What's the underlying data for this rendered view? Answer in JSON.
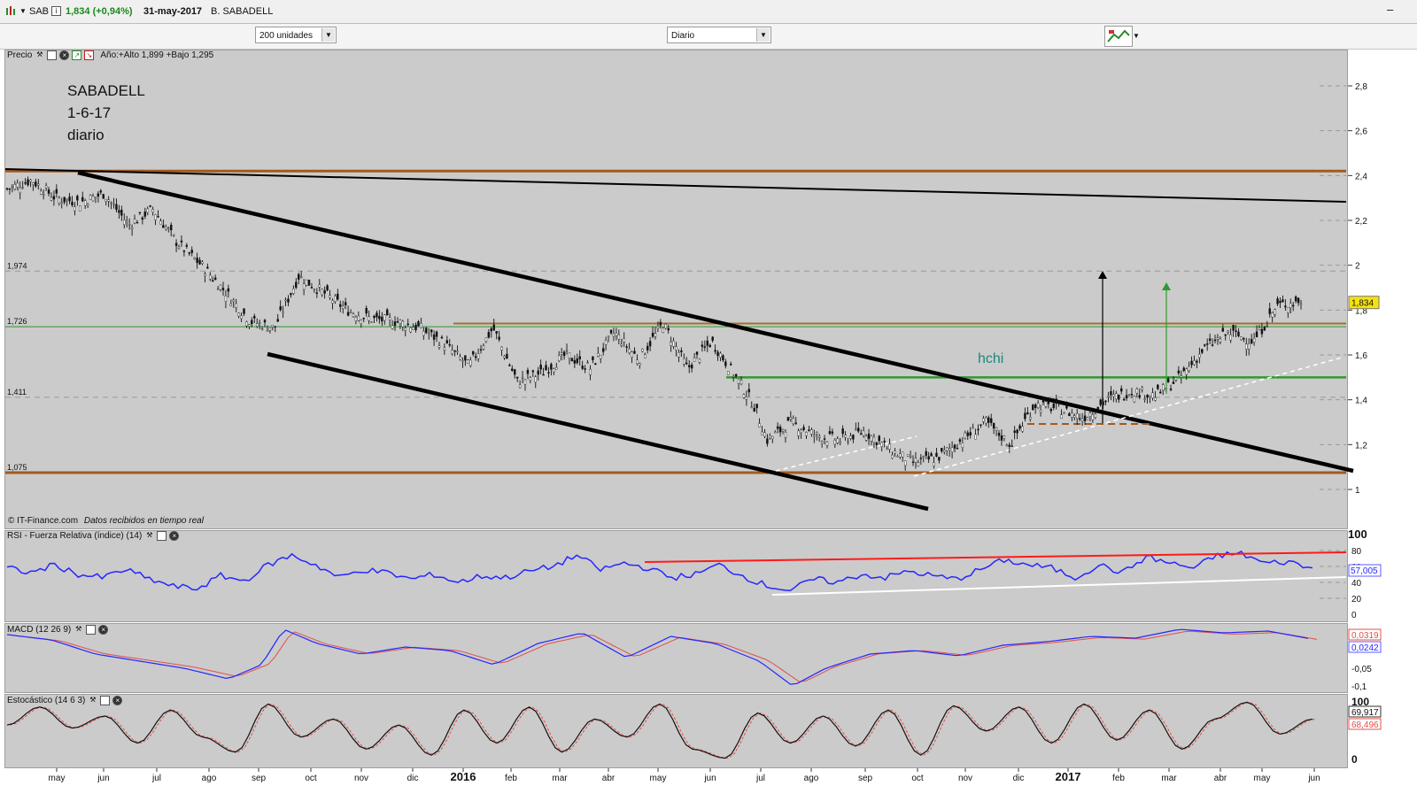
{
  "header": {
    "symbol": "SAB",
    "price_change": "1,834 (+0,94%)",
    "date": "31-may-2017",
    "name": "B. SABADELL"
  },
  "toolbar": {
    "units": "200 unidades",
    "period": "Diario"
  },
  "price_panel": {
    "legend_label": "Precio",
    "range_text": "Año:+Alto 1,899 +Bajo 1,295",
    "note_lines": [
      "SABADELL",
      "1-6-17",
      "diario"
    ],
    "annotation": "hchi",
    "copyright": "© IT-Finance.com",
    "realtime": "Datos recibidos en tiempo real",
    "y_ticks": [
      "2,8",
      "2,6",
      "2,4",
      "2,2",
      "2",
      "1,8",
      "1,6",
      "1,4",
      "1,2",
      "1"
    ],
    "level_labels": [
      "1,974",
      "1,726",
      "1,411",
      "1,075"
    ],
    "last_value": "1,834"
  },
  "rsi_panel": {
    "legend_label": "RSI - Fuerza Relativa (índice) (14)",
    "y_ticks": [
      "100",
      "80",
      "60",
      "40",
      "20",
      "0"
    ],
    "last_value": "57,005"
  },
  "macd_panel": {
    "legend_label": "MACD (12 26 9)",
    "y_ticks": [
      "-0,05",
      "-0,1"
    ],
    "values": [
      "0,0319",
      "0,0242"
    ]
  },
  "stoch_panel": {
    "legend_label": "Estocástico (14 6 3)",
    "y_ticks": [
      "100",
      "0"
    ],
    "values": [
      "69,917",
      "68,496"
    ]
  },
  "x_axis": {
    "labels": [
      "may",
      "jun",
      "jul",
      "ago",
      "sep",
      "oct",
      "nov",
      "dic",
      "2016",
      "feb",
      "mar",
      "abr",
      "may",
      "jun",
      "jul",
      "ago",
      "sep",
      "oct",
      "nov",
      "dic",
      "2017",
      "feb",
      "mar",
      "abr",
      "may",
      "jun"
    ],
    "bold": [
      "2016",
      "2017"
    ]
  },
  "colors": {
    "panel_bg": "#cbcbcb",
    "trend": "#000000",
    "level": "#a25a1f",
    "green_line": "#2f9a2f",
    "rsi": "#2626ff",
    "red": "#ff1a1a",
    "stoch_k": "#111111",
    "stoch_d": "#e0504b"
  },
  "chart_data": {
    "type": "candlestick",
    "title": "SABADELL 1-6-17 diario",
    "ylim": [
      0.9,
      2.95
    ],
    "close_series": [
      [
        0,
        2.34
      ],
      [
        14,
        2.38
      ],
      [
        28,
        2.3
      ],
      [
        42,
        2.28
      ],
      [
        56,
        2.32
      ],
      [
        70,
        2.18
      ],
      [
        84,
        2.25
      ],
      [
        98,
        2.1
      ],
      [
        112,
        2.0
      ],
      [
        126,
        1.88
      ],
      [
        140,
        1.75
      ],
      [
        154,
        1.72
      ],
      [
        168,
        1.95
      ],
      [
        182,
        1.88
      ],
      [
        196,
        1.8
      ],
      [
        210,
        1.76
      ],
      [
        224,
        1.75
      ],
      [
        238,
        1.72
      ],
      [
        252,
        1.65
      ],
      [
        266,
        1.55
      ],
      [
        280,
        1.72
      ],
      [
        294,
        1.48
      ],
      [
        308,
        1.52
      ],
      [
        322,
        1.6
      ],
      [
        336,
        1.54
      ],
      [
        350,
        1.7
      ],
      [
        364,
        1.58
      ],
      [
        378,
        1.74
      ],
      [
        392,
        1.54
      ],
      [
        406,
        1.66
      ],
      [
        420,
        1.5
      ],
      [
        430,
        1.38
      ],
      [
        438,
        1.22
      ],
      [
        452,
        1.3
      ],
      [
        466,
        1.24
      ],
      [
        480,
        1.22
      ],
      [
        494,
        1.26
      ],
      [
        508,
        1.18
      ],
      [
        522,
        1.12
      ],
      [
        536,
        1.14
      ],
      [
        550,
        1.22
      ],
      [
        564,
        1.3
      ],
      [
        578,
        1.2
      ],
      [
        592,
        1.38
      ],
      [
        606,
        1.36
      ],
      [
        620,
        1.32
      ],
      [
        634,
        1.4
      ],
      [
        648,
        1.44
      ],
      [
        662,
        1.42
      ],
      [
        676,
        1.5
      ],
      [
        690,
        1.63
      ],
      [
        704,
        1.7
      ],
      [
        718,
        1.66
      ],
      [
        732,
        1.82
      ],
      [
        746,
        1.84
      ]
    ],
    "rsi_series": [
      [
        0,
        58
      ],
      [
        10,
        52
      ],
      [
        20,
        62
      ],
      [
        30,
        50
      ],
      [
        40,
        46
      ],
      [
        50,
        56
      ],
      [
        60,
        44
      ],
      [
        70,
        35
      ],
      [
        80,
        32
      ],
      [
        90,
        48
      ],
      [
        100,
        42
      ],
      [
        110,
        62
      ],
      [
        120,
        74
      ],
      [
        130,
        62
      ],
      [
        140,
        46
      ],
      [
        150,
        56
      ],
      [
        160,
        52
      ],
      [
        170,
        44
      ],
      [
        180,
        50
      ],
      [
        190,
        40
      ],
      [
        200,
        48
      ],
      [
        210,
        46
      ],
      [
        220,
        54
      ],
      [
        230,
        60
      ],
      [
        240,
        74
      ],
      [
        250,
        56
      ],
      [
        260,
        64
      ],
      [
        270,
        58
      ],
      [
        280,
        46
      ],
      [
        290,
        50
      ],
      [
        300,
        62
      ],
      [
        310,
        48
      ],
      [
        320,
        36
      ],
      [
        330,
        30
      ],
      [
        340,
        44
      ],
      [
        350,
        40
      ],
      [
        360,
        50
      ],
      [
        370,
        46
      ],
      [
        380,
        54
      ],
      [
        390,
        48
      ],
      [
        400,
        44
      ],
      [
        410,
        56
      ],
      [
        420,
        68
      ],
      [
        430,
        62
      ],
      [
        440,
        58
      ],
      [
        450,
        46
      ],
      [
        460,
        62
      ],
      [
        470,
        52
      ],
      [
        480,
        72
      ],
      [
        490,
        64
      ],
      [
        500,
        58
      ],
      [
        510,
        74
      ],
      [
        520,
        76
      ],
      [
        530,
        64
      ],
      [
        540,
        66
      ],
      [
        550,
        57
      ]
    ],
    "macd_series": [
      [
        0,
        0.045
      ],
      [
        20,
        0.03
      ],
      [
        40,
        -0.01
      ],
      [
        60,
        -0.03
      ],
      [
        80,
        -0.05
      ],
      [
        100,
        -0.08
      ],
      [
        115,
        -0.04
      ],
      [
        125,
        0.06
      ],
      [
        140,
        0.02
      ],
      [
        160,
        -0.01
      ],
      [
        180,
        0.01
      ],
      [
        200,
        0.0
      ],
      [
        220,
        -0.04
      ],
      [
        240,
        0.02
      ],
      [
        260,
        0.05
      ],
      [
        280,
        -0.02
      ],
      [
        300,
        0.04
      ],
      [
        320,
        0.02
      ],
      [
        340,
        -0.03
      ],
      [
        355,
        -0.1
      ],
      [
        370,
        -0.05
      ],
      [
        390,
        -0.01
      ],
      [
        410,
        0.0
      ],
      [
        430,
        -0.015
      ],
      [
        450,
        0.015
      ],
      [
        470,
        0.025
      ],
      [
        490,
        0.04
      ],
      [
        510,
        0.035
      ],
      [
        530,
        0.06
      ],
      [
        550,
        0.05
      ],
      [
        570,
        0.055
      ],
      [
        590,
        0.032
      ]
    ],
    "stoch_series": [
      [
        0,
        60
      ],
      [
        15,
        90
      ],
      [
        30,
        55
      ],
      [
        45,
        75
      ],
      [
        60,
        30
      ],
      [
        75,
        85
      ],
      [
        90,
        40
      ],
      [
        105,
        15
      ],
      [
        120,
        95
      ],
      [
        135,
        40
      ],
      [
        150,
        70
      ],
      [
        165,
        20
      ],
      [
        180,
        60
      ],
      [
        195,
        10
      ],
      [
        210,
        85
      ],
      [
        225,
        30
      ],
      [
        240,
        90
      ],
      [
        255,
        15
      ],
      [
        270,
        70
      ],
      [
        285,
        40
      ],
      [
        300,
        95
      ],
      [
        315,
        20
      ],
      [
        330,
        5
      ],
      [
        345,
        80
      ],
      [
        360,
        30
      ],
      [
        375,
        75
      ],
      [
        390,
        25
      ],
      [
        405,
        85
      ],
      [
        420,
        10
      ],
      [
        435,
        92
      ],
      [
        450,
        50
      ],
      [
        465,
        90
      ],
      [
        480,
        30
      ],
      [
        495,
        95
      ],
      [
        510,
        35
      ],
      [
        525,
        85
      ],
      [
        540,
        20
      ],
      [
        555,
        70
      ],
      [
        570,
        98
      ],
      [
        585,
        45
      ],
      [
        600,
        70
      ]
    ]
  }
}
